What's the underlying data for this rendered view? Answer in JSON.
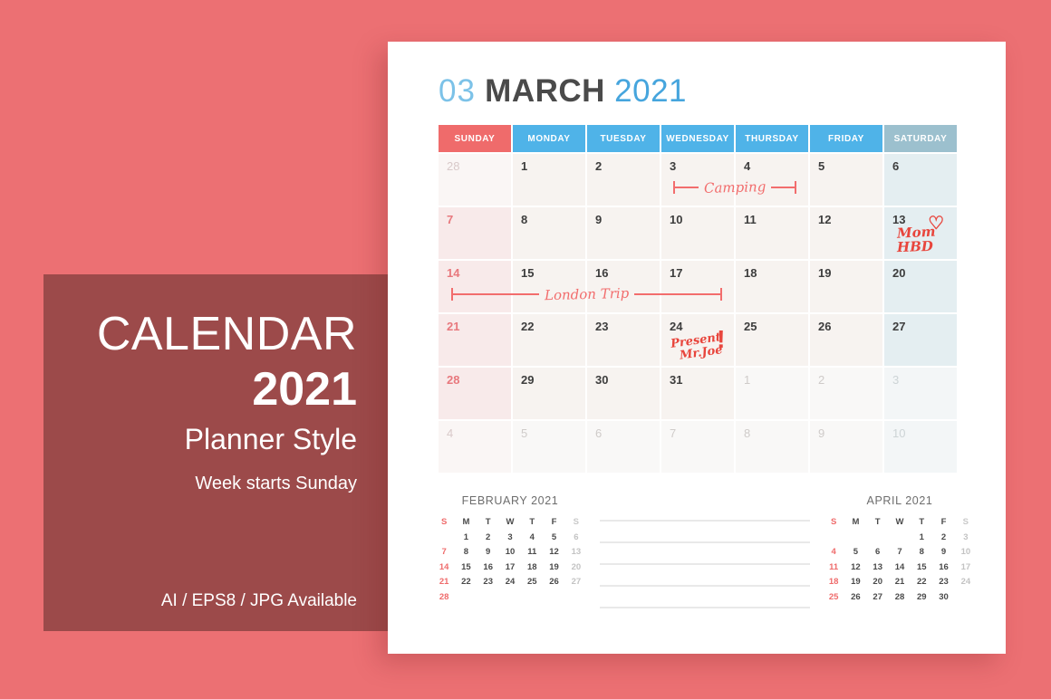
{
  "promo": {
    "title": "CALENDAR",
    "year": "2021",
    "subtitle": "Planner Style",
    "note": "Week starts Sunday",
    "formats": "AI / EPS8 / JPG  Available",
    "bg_color": "#9c4a4a"
  },
  "background_color": "#ec7073",
  "header": {
    "month_number": "03",
    "month_name": "MARCH",
    "year": "2021"
  },
  "colors": {
    "sunday_header": "#ef6b6b",
    "weekday_header": "#4fb3e8",
    "saturday_header": "#9cc0ce",
    "annotation": "#f26d6d",
    "annotation_bold": "#e8453c"
  },
  "weekdays": [
    "SUNDAY",
    "MONDAY",
    "TUESDAY",
    "WEDNESDAY",
    "THURSDAY",
    "FRIDAY",
    "SATURDAY"
  ],
  "weeks": [
    [
      {
        "n": "28",
        "out": true
      },
      {
        "n": "1"
      },
      {
        "n": "2"
      },
      {
        "n": "3"
      },
      {
        "n": "4"
      },
      {
        "n": "5"
      },
      {
        "n": "6"
      }
    ],
    [
      {
        "n": "7"
      },
      {
        "n": "8"
      },
      {
        "n": "9"
      },
      {
        "n": "10"
      },
      {
        "n": "11"
      },
      {
        "n": "12"
      },
      {
        "n": "13"
      }
    ],
    [
      {
        "n": "14"
      },
      {
        "n": "15"
      },
      {
        "n": "16"
      },
      {
        "n": "17"
      },
      {
        "n": "18"
      },
      {
        "n": "19"
      },
      {
        "n": "20"
      }
    ],
    [
      {
        "n": "21"
      },
      {
        "n": "22"
      },
      {
        "n": "23"
      },
      {
        "n": "24"
      },
      {
        "n": "25"
      },
      {
        "n": "26"
      },
      {
        "n": "27"
      }
    ],
    [
      {
        "n": "28"
      },
      {
        "n": "29"
      },
      {
        "n": "30"
      },
      {
        "n": "31"
      },
      {
        "n": "1",
        "out": true
      },
      {
        "n": "2",
        "out": true
      },
      {
        "n": "3",
        "out": true
      }
    ],
    [
      {
        "n": "4",
        "out": true
      },
      {
        "n": "5",
        "out": true
      },
      {
        "n": "6",
        "out": true
      },
      {
        "n": "7",
        "out": true
      },
      {
        "n": "8",
        "out": true
      },
      {
        "n": "9",
        "out": true
      },
      {
        "n": "10",
        "out": true
      }
    ]
  ],
  "annotations": {
    "camping": "Camping",
    "london_trip": "London Trip",
    "mom_line1": "Mom",
    "mom_line2": "HBD",
    "heart": "heart-icon",
    "present_line1": "Present",
    "present_line2": "Mr.Joe",
    "exclamation": "!"
  },
  "mini_calendars": [
    {
      "title": "FEBRUARY 2021",
      "headers": [
        "S",
        "M",
        "T",
        "W",
        "T",
        "F",
        "S"
      ],
      "days": [
        "",
        "1",
        "2",
        "3",
        "4",
        "5",
        "6",
        "7",
        "8",
        "9",
        "10",
        "11",
        "12",
        "13",
        "14",
        "15",
        "16",
        "17",
        "18",
        "19",
        "20",
        "21",
        "22",
        "23",
        "24",
        "25",
        "26",
        "27",
        "28",
        "",
        "",
        "",
        "",
        "",
        ""
      ]
    },
    {
      "title": "APRIL 2021",
      "headers": [
        "S",
        "M",
        "T",
        "W",
        "T",
        "F",
        "S"
      ],
      "days": [
        "",
        "",
        "",
        "",
        "1",
        "2",
        "3",
        "4",
        "5",
        "6",
        "7",
        "8",
        "9",
        "10",
        "11",
        "12",
        "13",
        "14",
        "15",
        "16",
        "17",
        "18",
        "19",
        "20",
        "21",
        "22",
        "23",
        "24",
        "25",
        "26",
        "27",
        "28",
        "29",
        "30",
        ""
      ]
    }
  ],
  "notes_lines_count": 5
}
